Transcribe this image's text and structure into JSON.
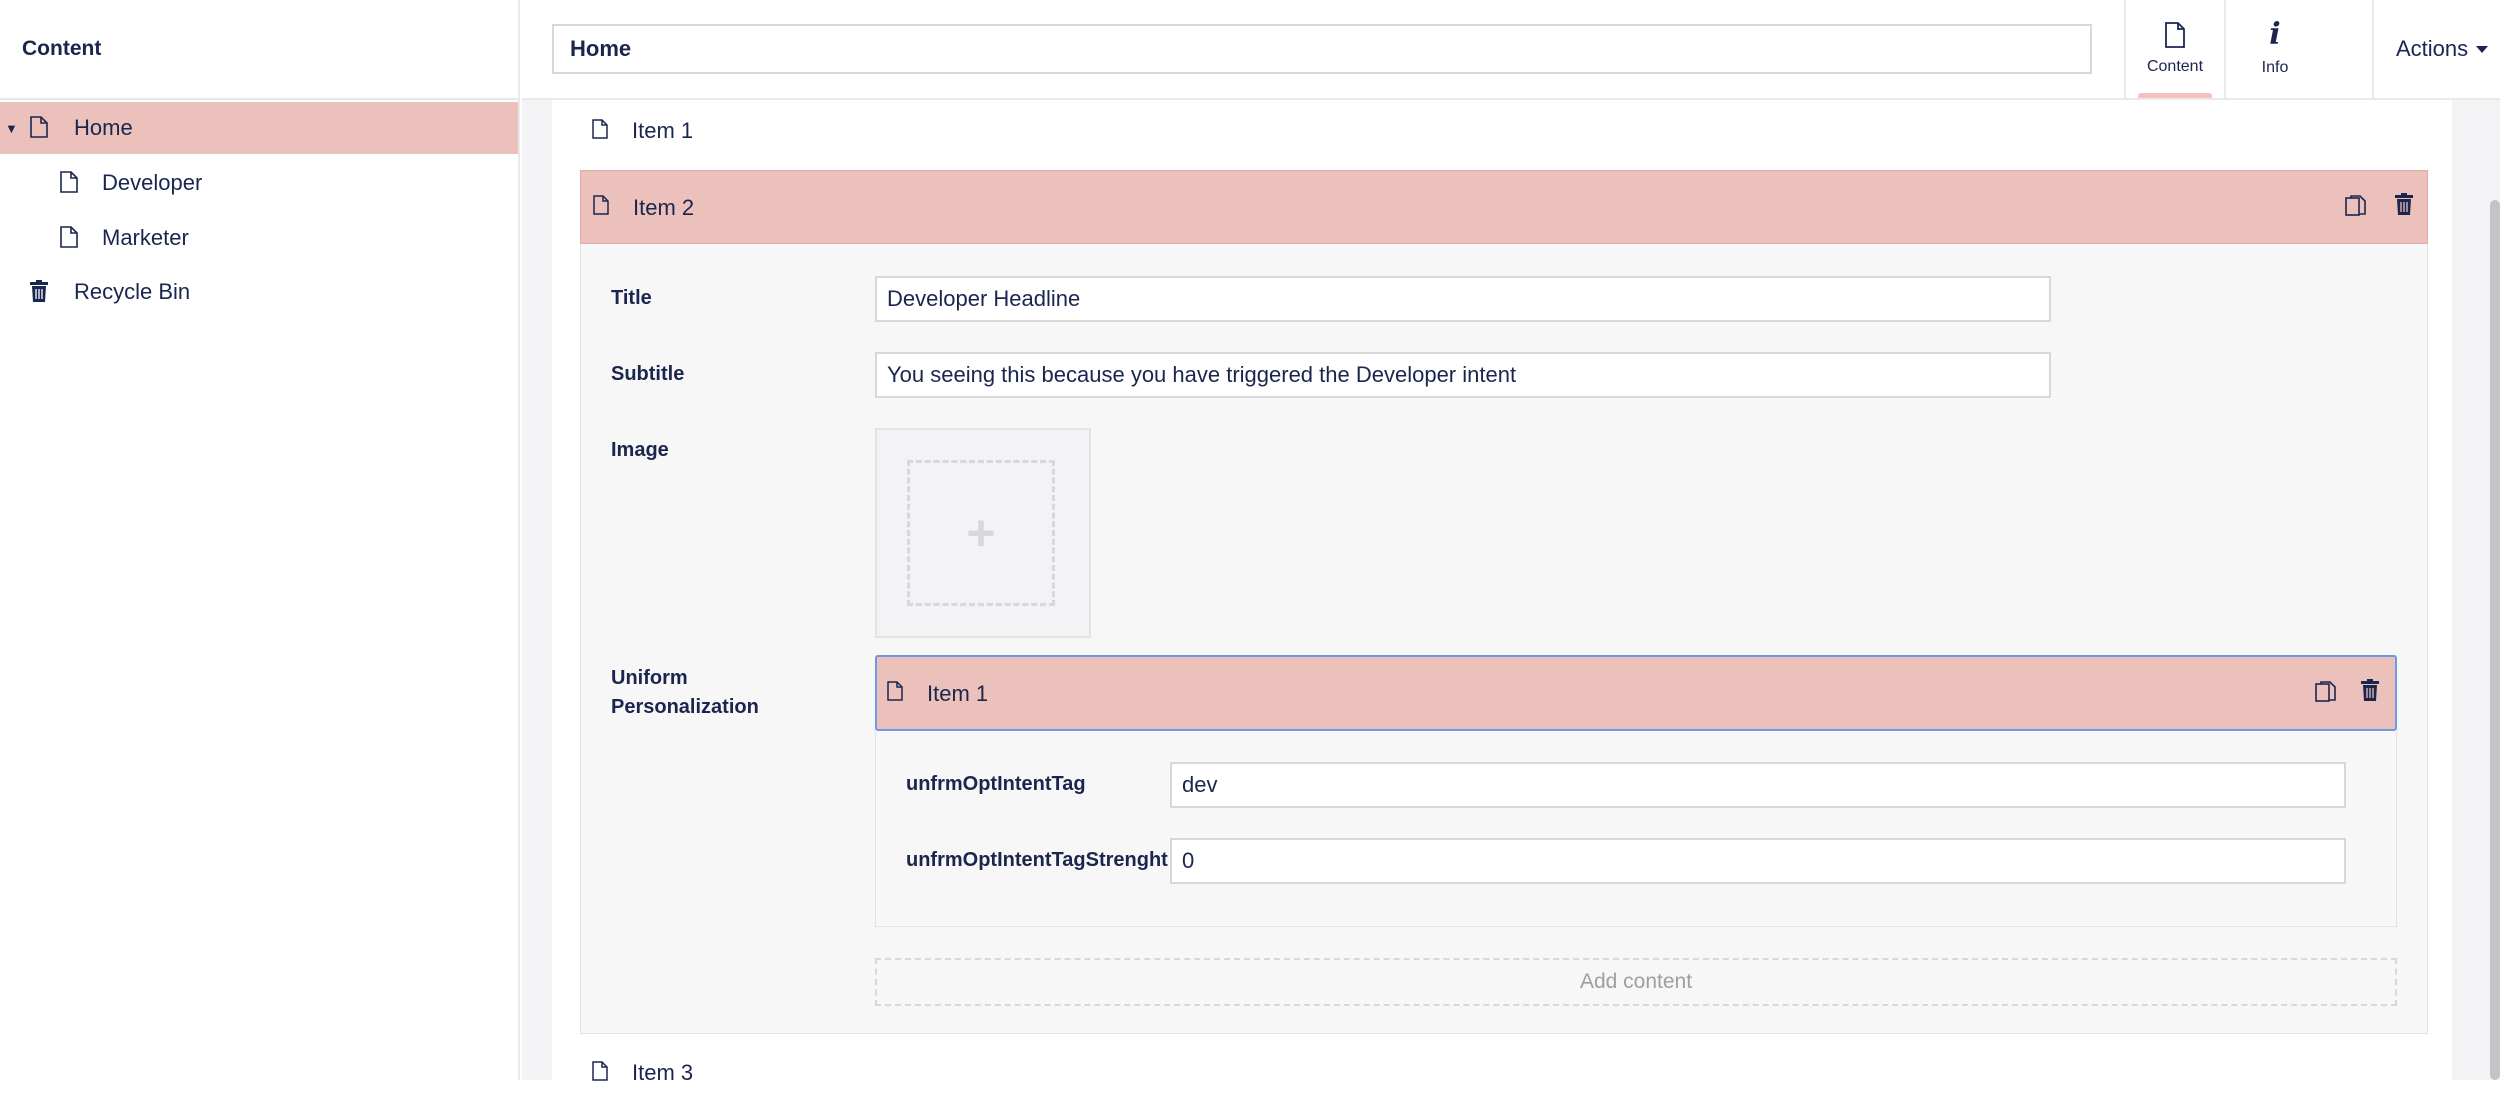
{
  "sidebar": {
    "title": "Content",
    "tree": [
      {
        "label": "Home",
        "icon": "document-icon",
        "expanded": true,
        "active": true
      },
      {
        "label": "Developer",
        "icon": "document-icon"
      },
      {
        "label": "Marketer",
        "icon": "document-icon"
      },
      {
        "label": "Recycle Bin",
        "icon": "trash-icon"
      }
    ]
  },
  "header": {
    "name_value": "Home",
    "apps": [
      {
        "label": "Content",
        "icon": "document-icon",
        "active": true
      },
      {
        "label": "Info",
        "icon": "info-icon"
      }
    ],
    "actions_label": "Actions"
  },
  "blocks": {
    "item1": {
      "label": "Item 1"
    },
    "item2": {
      "label": "Item 2",
      "fields": {
        "title_label": "Title",
        "title_value": "Developer Headline",
        "subtitle_label": "Subtitle",
        "subtitle_value": "You seeing this because you have triggered the Developer intent",
        "image_label": "Image",
        "image_add_symbol": "+",
        "personalization_label_line1": "Uniform",
        "personalization_label_line2": "Personalization"
      },
      "nested": {
        "label": "Item 1",
        "intent_tag_label": "unfrmOptIntentTag",
        "intent_tag_value": "dev",
        "intent_strength_label": "unfrmOptIntentTagStrenght",
        "intent_strength_value": "0"
      },
      "add_content_label": "Add content"
    },
    "item3": {
      "label": "Item 3"
    }
  },
  "colors": {
    "accent_pink": "#ecc1bc",
    "text_navy": "#1b264f",
    "focus_blue": "#6d9ae3"
  }
}
